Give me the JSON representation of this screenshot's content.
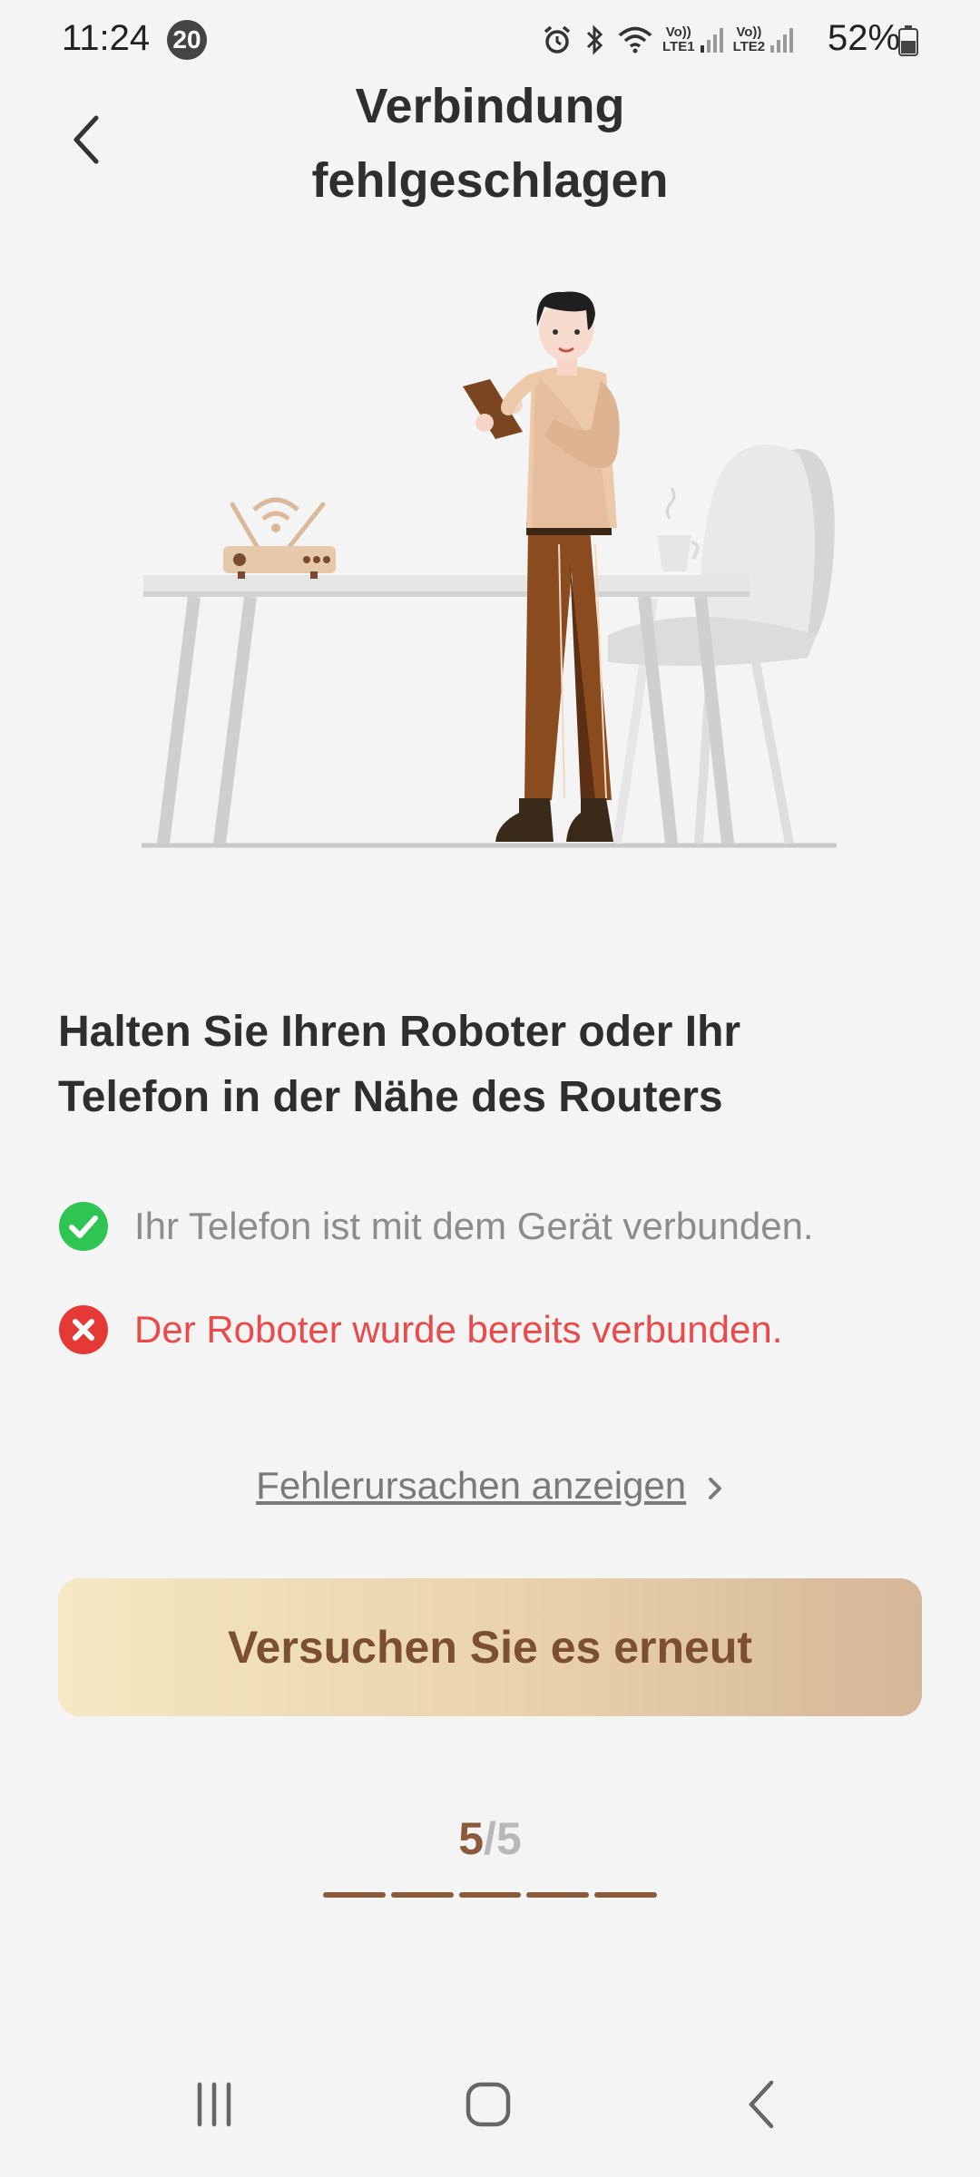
{
  "status_bar": {
    "time": "11:24",
    "notification_count": "20",
    "sim1_label": "Vo)) LTE1",
    "sim1_top": "Vo))",
    "sim1_bottom": "LTE1",
    "sim2_top": "Vo))",
    "sim2_bottom": "LTE2",
    "battery_percent": "52%",
    "icons": [
      "alarm-icon",
      "bluetooth-icon",
      "wifi-icon",
      "signal-icon",
      "signal-icon",
      "battery-icon"
    ]
  },
  "header": {
    "title": "Verbindung fehlgeschlagen",
    "back_icon": "chevron-left-icon"
  },
  "illustration": {
    "description_icons": [
      "router-icon",
      "table",
      "person-with-tablet",
      "chair",
      "cup"
    ]
  },
  "content": {
    "instruction": "Halten Sie Ihren Roboter oder Ihr Telefon in der Nähe des Routers",
    "checks": [
      {
        "status": "ok",
        "text": "Ihr Telefon ist mit dem Gerät verbunden.",
        "icon": "check-circle-icon"
      },
      {
        "status": "error",
        "text": "Der Roboter wurde bereits verbunden.",
        "icon": "error-circle-icon"
      }
    ],
    "cause_link": "Fehlerursachen anzeigen",
    "retry_button": "Versuchen Sie es erneut"
  },
  "step": {
    "current": "5",
    "separator": "/",
    "total": "5",
    "progress_fraction": 1.0
  },
  "colors": {
    "accent": "#8a5a3b",
    "error": "#e94b4b",
    "success": "#2fc553",
    "button_gradient_start": "#f5e8c2",
    "button_gradient_end": "#d5b797"
  },
  "nav_bar": {
    "icons": [
      "recent-apps-icon",
      "home-icon",
      "back-icon"
    ]
  }
}
